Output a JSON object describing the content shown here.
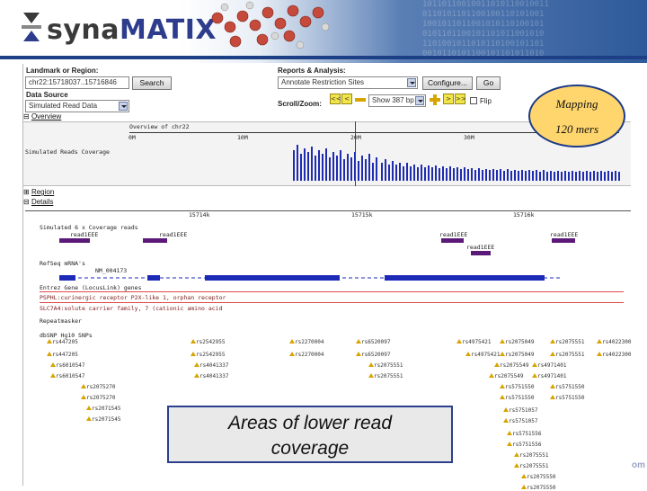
{
  "brand": {
    "part1": "syna",
    "part2": "MATIX",
    "accent": "#2d3c8c"
  },
  "binary_text": "10110110010011010110010011\n0110101101100100110101001\n1001011011001010110100101\n0101101100101101011001010\n1101001011010110100101101\n0010110101100101101011010",
  "form": {
    "landmark_label": "Landmark or Region:",
    "landmark_value": "chr22:15718037..15716846",
    "search_label": "Search",
    "reports_label": "Reports & Analysis:",
    "reports_value": "Annotate Restriction Sites",
    "configure_label": "Configure...",
    "go_label": "Go",
    "datasource_label": "Data Source",
    "datasource_value": "Simulated Read Data",
    "scroll_label": "Scroll/Zoom:",
    "zoom_value": "Show 387 bp",
    "flip_label": "Flip",
    "left2": "<<<",
    "left1": "<",
    "right1": ">",
    "right2": ">>"
  },
  "overview": {
    "tab_label": "Overview",
    "title": "Overview of chr22",
    "ticks": [
      "0M",
      "10M",
      "20M",
      "30M"
    ],
    "track_label": "Simulated Reads Coverage"
  },
  "region_tab": "Region",
  "details": {
    "tab_label": "Details",
    "ticks": [
      "15714k",
      "15715k",
      "15716k"
    ],
    "track1": "Simulated 6 x Coverage reads",
    "reads": [
      "read1EEE",
      "read1EEE",
      "read1EEE",
      "read1EEE",
      "read1EEE"
    ],
    "refseq": "RefSeq mRNA's",
    "refseq_id": "NM_004173",
    "entrez": "Entrez Gene (LocusLink) genes",
    "gene1": "PSPHL:curinergic receptor P2X-like 1, orphan receptor",
    "gene2": "SLC7A4:solute carrier family, 7 (cationic amino acid",
    "repeat": "Repeatmasker",
    "snp": "dbSNP Hg10 SNPs",
    "snp_col1": [
      "rs447205",
      "rs447205",
      "rs6010547",
      "rs6010547",
      "rs2075270",
      "rs2075270",
      "rs2071545",
      "rs2071545"
    ],
    "snp_col2": [
      "rs2542955",
      "rs2542955",
      "rs4041337",
      "rs4041337"
    ],
    "snp_col3": [
      "rs2270004",
      "rs2270004"
    ],
    "snp_col4": [
      "rs6520097",
      "rs6520097",
      "rs2075551",
      "rs2075551"
    ],
    "snp_col5": [
      "rs4975421",
      "rs4975421",
      "rs2075049",
      "rs2075049"
    ],
    "snp_col6": [
      "rs2075549",
      "rs2075549",
      "rs4971401",
      "rs4971401",
      "rs5751550",
      "rs5751550",
      "rs5751057",
      "rs5751057",
      "rs5751556",
      "rs5751556",
      "rs2075551",
      "rs2075551",
      "rs2075550",
      "rs2075550"
    ],
    "snp_col7": [
      "rs2075551",
      "rs2075551",
      "rs4971401",
      "rs4971401",
      "rs5751550",
      "rs5751550"
    ],
    "snp_col8": [
      "rs4022300",
      "rs4022300"
    ]
  },
  "callouts": {
    "mapping_line1": "Mapping",
    "mapping_line2": "120 mers",
    "areas_line1": "Areas of lower read",
    "areas_line2": "coverage"
  },
  "footer": "om"
}
